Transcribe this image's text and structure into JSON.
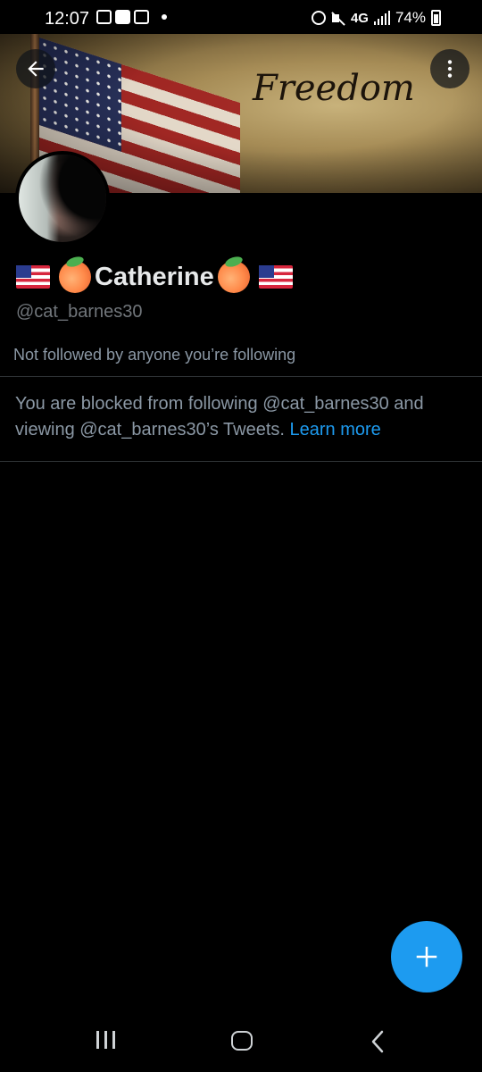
{
  "status_bar": {
    "time": "12:07",
    "network": "4G",
    "battery": "74%"
  },
  "banner": {
    "text": "Freedom"
  },
  "profile": {
    "display_name": "Catherine",
    "handle": "@cat_barnes30",
    "followed_note": "Not followed by anyone you’re following"
  },
  "blocked": {
    "message": "You are blocked from following @cat_barnes30 and viewing @cat_barnes30’s Tweets.",
    "learn_more": "Learn more"
  },
  "colors": {
    "accent": "#1d9bf0",
    "background": "#000000",
    "secondary_text": "#71767b"
  },
  "icons": {
    "back": "arrow-left-icon",
    "more": "more-vertical-icon",
    "fab": "plus-icon"
  }
}
